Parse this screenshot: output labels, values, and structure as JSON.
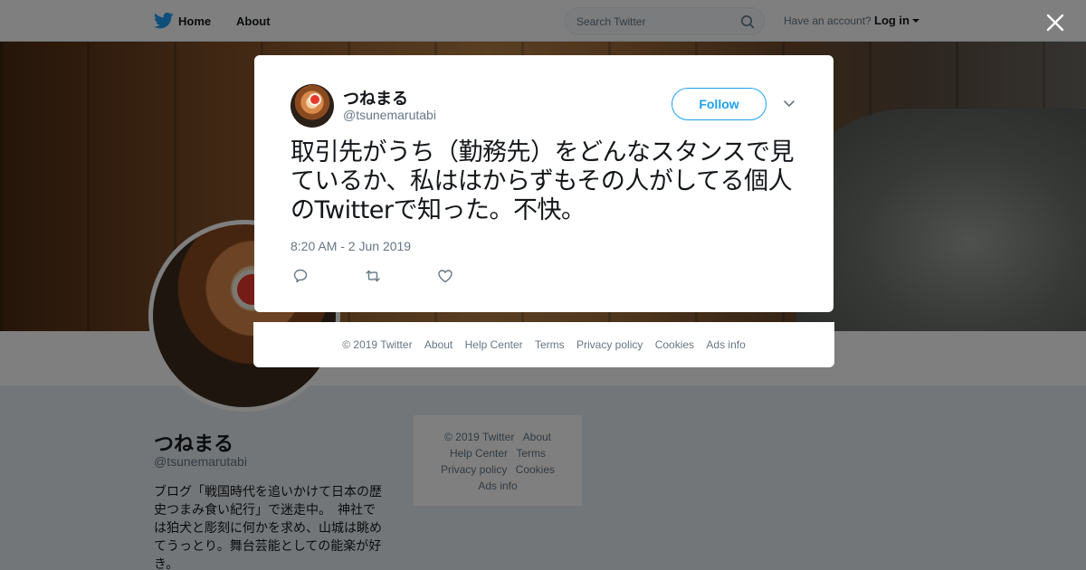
{
  "nav": {
    "home_label": "Home",
    "about_label": "About",
    "search_placeholder": "Search Twitter",
    "account_text": "Have an account?",
    "login_label": "Log in",
    "bird_icon": "twitter-bird-icon",
    "brand_color": "#1da1f2"
  },
  "profile": {
    "name": "つねまる",
    "handle": "@tsunemarutabi",
    "bio": "ブログ「戦国時代を追いかけて日本の歴史つまみ食い紀行」で迷走中。　神社では狛犬と彫刻に何かを求め、山城は眺めてうっとり。舞台芸能としての能楽が好き。"
  },
  "sidebar_footer": {
    "links": [
      "© 2019 Twitter",
      "About",
      "Help Center",
      "Terms",
      "Privacy policy",
      "Cookies",
      "Ads info"
    ]
  },
  "tweet": {
    "name": "つねまる",
    "handle": "@tsunemarutabi",
    "follow_label": "Follow",
    "text": "取引先がうち（勤務先）をどんなスタンスで見ているか、私ははからずもその人がしてる個人のTwitterで知った。不快。",
    "timestamp": "8:20 AM - 2 Jun 2019",
    "actions": [
      "reply-icon",
      "retweet-icon",
      "like-icon"
    ]
  },
  "modal_footer": {
    "links": [
      "© 2019 Twitter",
      "About",
      "Help Center",
      "Terms",
      "Privacy policy",
      "Cookies",
      "Ads info"
    ]
  }
}
